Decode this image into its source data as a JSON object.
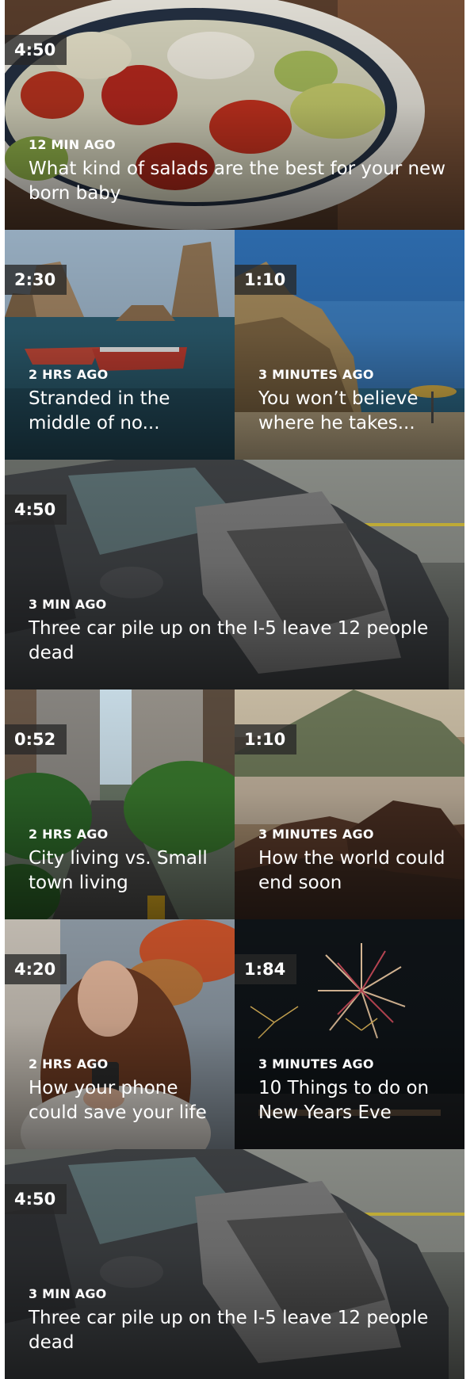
{
  "feed": {
    "items": [
      {
        "duration": "4:50",
        "time": "12 MIN AGO",
        "title": "What kind of salads are the best for your new born baby",
        "image": "salad-bowl"
      },
      {
        "duration": "2:30",
        "time": "2 HRS AGO",
        "title": "Stranded in the middle of no...",
        "image": "boats-sea-rocks"
      },
      {
        "duration": "1:10",
        "time": "3 MINUTES AGO",
        "title": "You won’t believe where he takes...",
        "image": "beach-cliffs"
      },
      {
        "duration": "4:50",
        "time": "3 MIN AGO",
        "title": "Three car pile up on the I-5 leave 12 people dead",
        "image": "crashed-car"
      },
      {
        "duration": "0:52",
        "time": "2 HRS AGO",
        "title": "City living vs. Small town living",
        "image": "city-street"
      },
      {
        "duration": "1:10",
        "time": "3 MINUTES AGO",
        "title": "How the world could end soon",
        "image": "volcano-landscape"
      },
      {
        "duration": "4:20",
        "time": "2 HRS AGO",
        "title": "How your phone could save your life",
        "image": "woman-phone"
      },
      {
        "duration": "1:84",
        "time": "3 MINUTES AGO",
        "title": "10 Things to do on New Years Eve",
        "image": "fireworks"
      },
      {
        "duration": "4:50",
        "time": "3 MIN AGO",
        "title": "Three car pile up on the I-5 leave 12 people dead",
        "image": "crashed-car"
      }
    ]
  }
}
